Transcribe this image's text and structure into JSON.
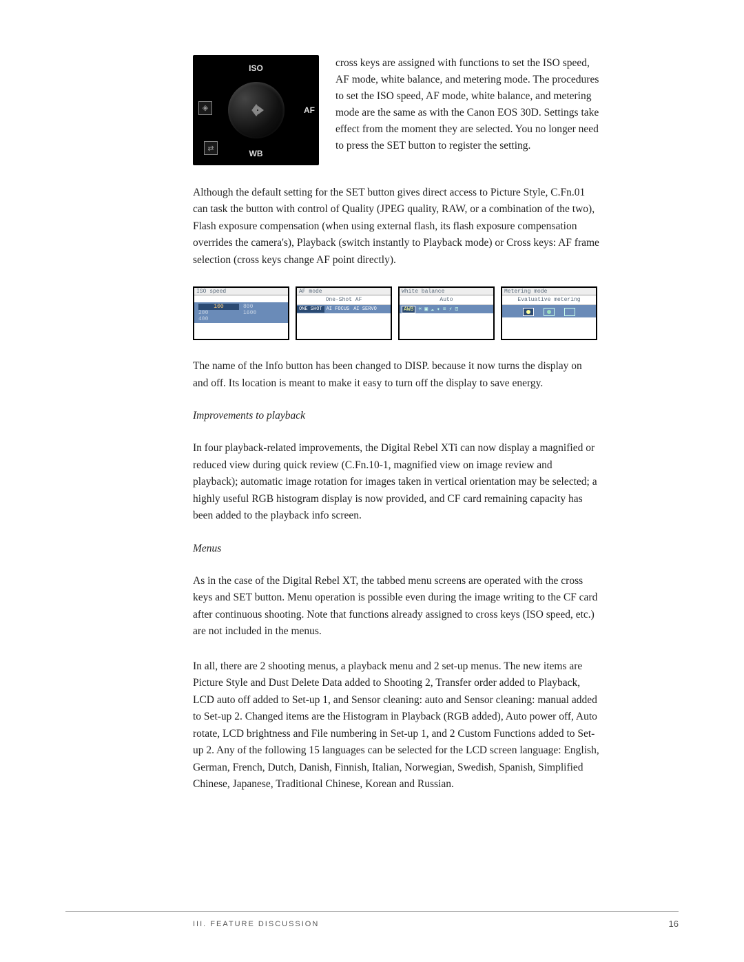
{
  "camera": {
    "top_label": "ISO",
    "right_label": "AF",
    "bottom_label": "WB"
  },
  "intro_side": "cross keys are assigned with functions to set the ISO speed, AF mode, white balance, and metering mode.  The procedures to set the ISO speed, AF mode, white balance, and metering mode are the same as with the Canon EOS 30D.  Settings take effect from the moment they are selected.  You no longer need to press the SET button to register the setting.",
  "para_set_button": "Although the default setting for the SET button gives direct access to Picture Style, C.Fn.01 can task the button with control of Quality (JPEG quality, RAW, or a combination of the two), Flash exposure compensation (when using external flash, its flash exposure compensation overrides the camera's), Playback (switch instantly to Playback mode) or Cross keys: AF frame selection (cross keys change AF point directly).",
  "menus": {
    "iso": {
      "title": "ISO speed",
      "selected": "100",
      "values": [
        "100",
        "800",
        "200",
        "1600",
        "400",
        ""
      ]
    },
    "af": {
      "title": "AF mode",
      "sub": "One-Shot AF",
      "selected": "ONE SHOT",
      "options": [
        "ONE SHOT",
        "AI FOCUS",
        "AI SERVO"
      ]
    },
    "wb": {
      "title": "White balance",
      "sub": "Auto",
      "selected": "AWB"
    },
    "metering": {
      "title": "Metering mode",
      "sub": "Evaluative metering"
    }
  },
  "para_disp": "The name of the Info button has been changed to DISP. because it now turns the display on and off.  Its location is meant to make it easy to turn off the display to save energy.",
  "head_playback": "Improvements to playback",
  "para_playback": "In four playback-related improvements, the Digital Rebel XTi can now display a magnified or reduced view during quick review (C.Fn.10-1, magnified view on image review and playback); automatic image rotation for images taken in vertical orientation may be selected; a highly useful RGB histogram display is now provided, and CF card remaining capacity has been added to the playback info screen.",
  "head_menus": "Menus",
  "para_menus1": "As in the case of the Digital Rebel XT, the tabbed menu screens are operated with the cross keys and SET button.   Menu operation is possible even during the image writing to the CF card after continuous shooting. Note that functions already assigned to cross keys  (ISO speed, etc.) are not included in the menus.",
  "para_menus2": "In all, there are 2 shooting menus, a playback menu and 2 set-up menus.  The new items are Picture Style and Dust Delete Data added to Shooting 2, Transfer order added to Playback, LCD auto off added to Set-up 1, and Sensor cleaning: auto and Sensor cleaning: manual added to Set-up 2. Changed items are the Histogram in Playback (RGB added), Auto power off, Auto rotate, LCD brightness and File numbering in Set-up 1, and 2 Custom Functions added to Set-up 2.  Any of the following 15 languages can be selected for the LCD screen language: English, German, French, Dutch, Danish, Finnish, Italian, Norwegian, Swedish, Spanish, Simplified Chinese, Japanese, Traditional Chinese, Korean and Russian.",
  "footer": {
    "section": "III. FEATURE DISCUSSION",
    "page": "16"
  }
}
